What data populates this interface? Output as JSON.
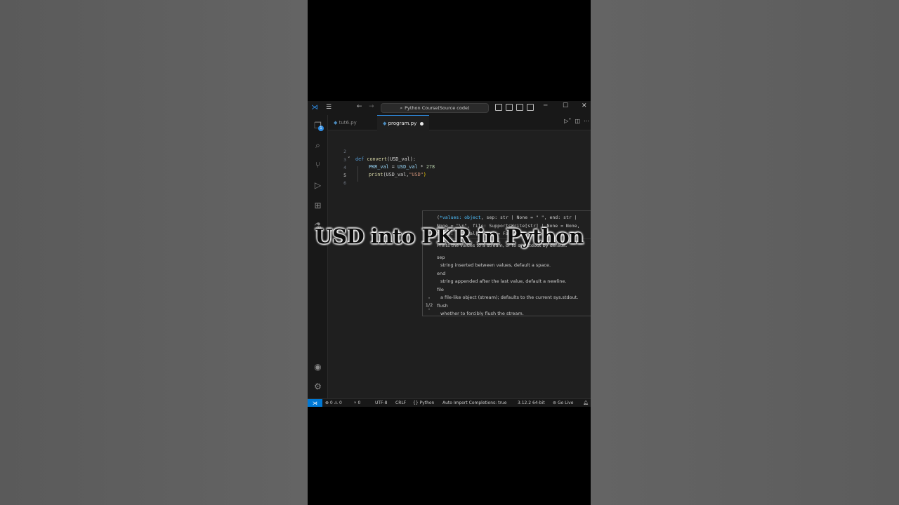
{
  "overlay_title": "USD into PKR in Python",
  "titlebar": {
    "search_text": "Python Course(Source code)",
    "minimize": "─",
    "maximize": "☐",
    "close": "✕"
  },
  "tabs": [
    {
      "label": "tut6.py"
    },
    {
      "label": "program.py"
    }
  ],
  "explorer_badge": "1",
  "line_numbers": [
    "2",
    "3",
    "4",
    "5",
    "6"
  ],
  "code": {
    "line3_kw": "def ",
    "line3_fn": "convert",
    "line3_rest": "(USD_val):",
    "line4_var": "PKR_val",
    "line4_eq": " = ",
    "line4_var2": "USD_val",
    "line4_op": " * ",
    "line4_num": "278",
    "line5_fn": "print",
    "line5_open": "(USD_val,",
    "line5_str": "\"USD\"",
    "line5_close": ")"
  },
  "hover": {
    "sig_param": "*values: object",
    "sig_line1": ", sep: str | None = \" \", end: str |",
    "sig_line2": "None = \"\\n\", file: SupportsWrite[str] | None = None,",
    "sig_line3": "flush: Literal[False] = False) -> None",
    "sig_open": "(",
    "description": "Prints the values to a stream, or to sys.stdout by default.",
    "params": [
      {
        "name": "sep",
        "desc": "string inserted between values, default a space."
      },
      {
        "name": "end",
        "desc": "string appended after the last value, default a newline."
      },
      {
        "name": "file",
        "desc": "a file-like object (stream); defaults to the current sys.stdout."
      },
      {
        "name": "flush",
        "desc": "whether to forcibly flush the stream."
      }
    ],
    "pager": "1/2"
  },
  "statusbar": {
    "problems": "⊗ 0 ⚠ 0",
    "ports": "⑂ 0",
    "encoding": "UTF-8",
    "eol": "CRLF",
    "language": "Python",
    "auto_import": "Auto Import Completions: true",
    "interpreter": "3.12.2 64-bit",
    "go_live": "Go Live"
  },
  "colors": {
    "accent": "#2f8ee6",
    "editor_bg": "#1f1f1f",
    "keyword": "#569cd6",
    "function": "#dcdcaa",
    "variable": "#9cdcfe",
    "string": "#ce9178",
    "number": "#b5cea8"
  }
}
